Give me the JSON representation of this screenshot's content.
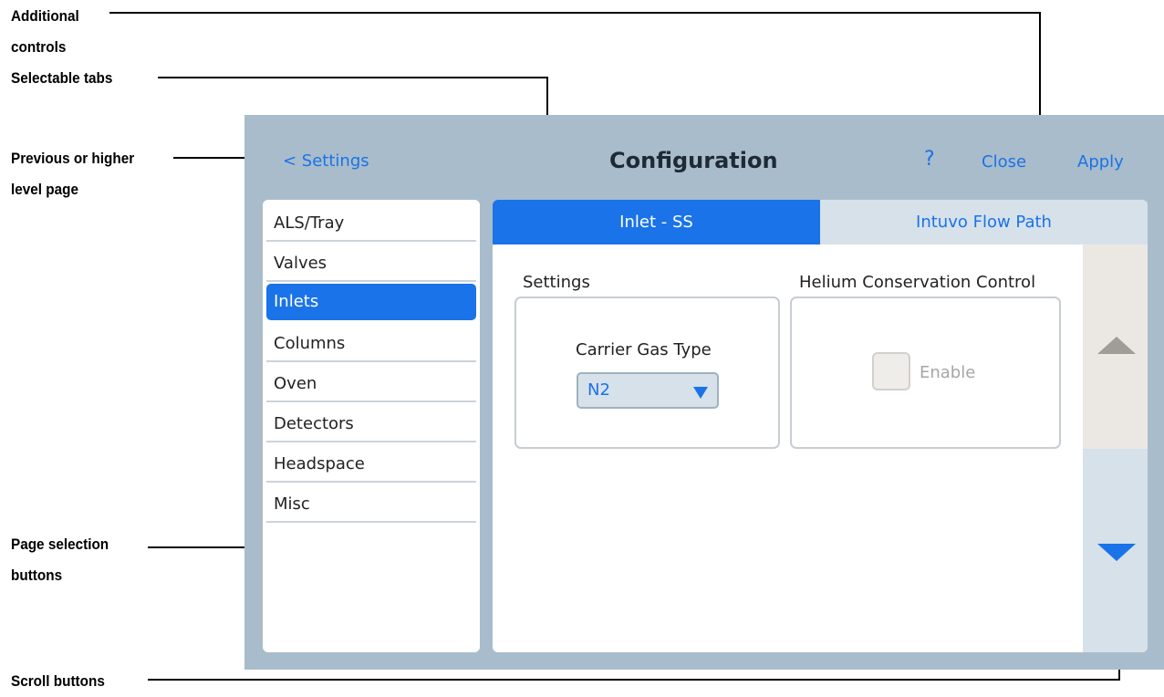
{
  "annotations": {
    "additional_controls": "Additional\ncontrols",
    "selectable_tabs": "Selectable tabs",
    "previous_page": "Previous or higher\nlevel page",
    "page_selection": "Page selection\nbuttons",
    "scroll_buttons": "Scroll buttons"
  },
  "header": {
    "back_label": "< Settings",
    "title": "Configuration",
    "help_label": "?",
    "close_label": "Close",
    "apply_label": "Apply"
  },
  "sidebar": {
    "items": [
      {
        "label": "ALS/Tray",
        "active": false
      },
      {
        "label": "Valves",
        "active": false
      },
      {
        "label": "Inlets",
        "active": true
      },
      {
        "label": "Columns",
        "active": false
      },
      {
        "label": "Oven",
        "active": false
      },
      {
        "label": "Detectors",
        "active": false
      },
      {
        "label": "Headspace",
        "active": false
      },
      {
        "label": "Misc",
        "active": false
      }
    ]
  },
  "tabs": [
    {
      "label": "Inlet - SS",
      "active": true
    },
    {
      "label": "Intuvo Flow Path",
      "active": false
    }
  ],
  "settings": {
    "section_label": "Settings",
    "carrier_gas_label": "Carrier Gas Type",
    "carrier_gas_value": "N2"
  },
  "helium": {
    "section_label": "Helium Conservation Control",
    "enable_label": "Enable",
    "enabled": false
  },
  "colors": {
    "accent": "#1a73e8",
    "frame": "#a9bccb",
    "inactive_tab": "#d6e1ea"
  },
  "icons": {
    "scroll_up": "triangle-up-icon",
    "scroll_down": "triangle-down-icon",
    "dropdown": "triangle-down-icon"
  }
}
